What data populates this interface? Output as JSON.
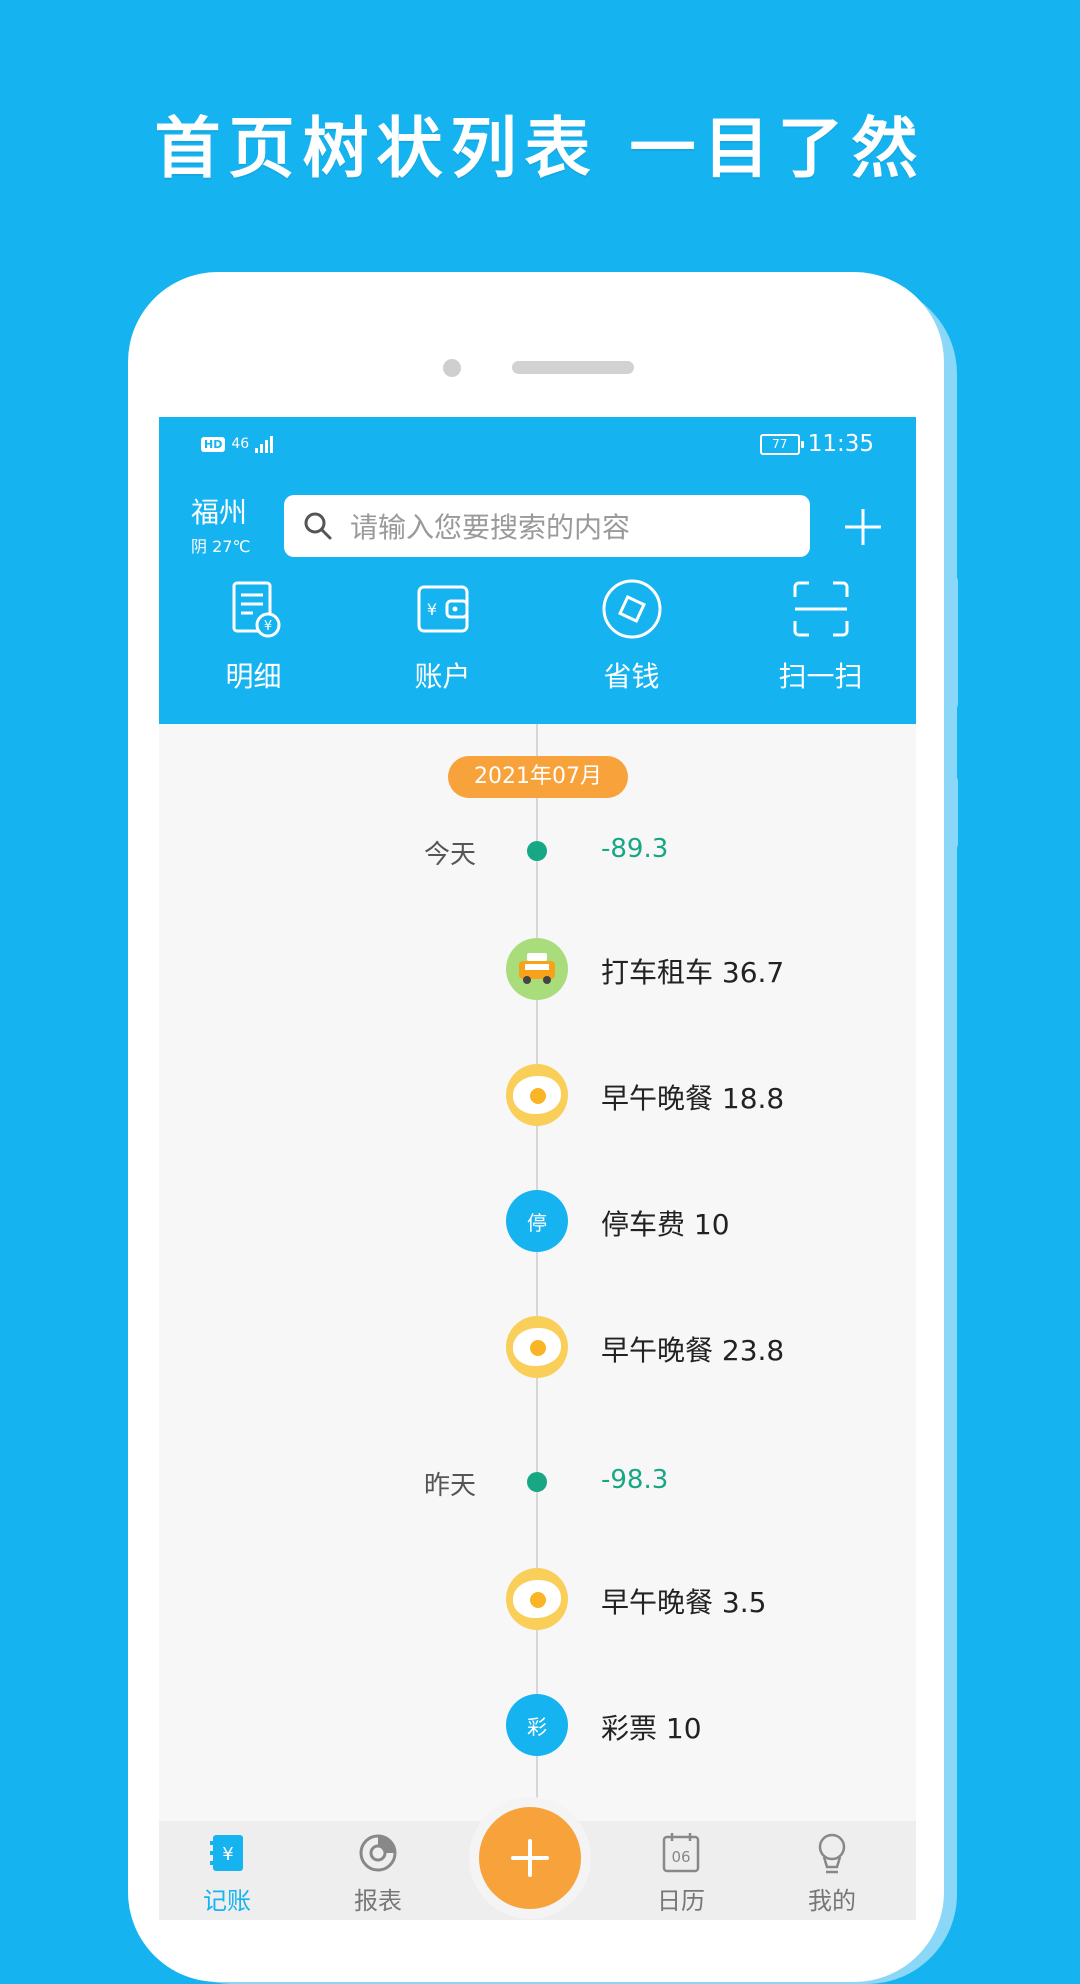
{
  "banner": {
    "title": "首页树状列表  一目了然"
  },
  "status_bar": {
    "hd": "HD",
    "network": "46",
    "battery": "77",
    "time": "11:35"
  },
  "header": {
    "city": "福州",
    "weather": "阴 27℃",
    "search_placeholder": "请输入您要搜索的内容"
  },
  "quick_actions": [
    {
      "label": "明细",
      "icon": "bill-icon"
    },
    {
      "label": "账户",
      "icon": "wallet-icon"
    },
    {
      "label": "省钱",
      "icon": "save-money-icon"
    },
    {
      "label": "扫一扫",
      "icon": "scan-icon"
    }
  ],
  "timeline": {
    "month": "2021年07月",
    "days": [
      {
        "label": "今天",
        "total": "-89.3",
        "entries": [
          {
            "text": "打车租车 36.7",
            "icon": "taxi-icon"
          },
          {
            "text": "早午晚餐 18.8",
            "icon": "fried-egg-icon"
          },
          {
            "text": "停车费 10",
            "icon": "parking-icon",
            "badge": "停"
          },
          {
            "text": "早午晚餐 23.8",
            "icon": "fried-egg-icon"
          }
        ]
      },
      {
        "label": "昨天",
        "total": "-98.3",
        "entries": [
          {
            "text": "早午晚餐 3.5",
            "icon": "fried-egg-icon"
          },
          {
            "text": "彩票 10",
            "icon": "lottery-icon",
            "badge": "彩"
          }
        ]
      }
    ]
  },
  "tabbar": {
    "items": [
      {
        "label": "记账",
        "icon": "ledger-icon",
        "active": true
      },
      {
        "label": "报表",
        "icon": "report-icon",
        "active": false
      },
      {
        "label": "日历",
        "icon": "calendar-icon",
        "active": false,
        "date": "06"
      },
      {
        "label": "我的",
        "icon": "profile-icon",
        "active": false
      }
    ],
    "fab_icon": "plus-icon"
  },
  "colors": {
    "brand": "#16b3f1",
    "accent": "#f7a23b",
    "positive": "#17a785"
  }
}
